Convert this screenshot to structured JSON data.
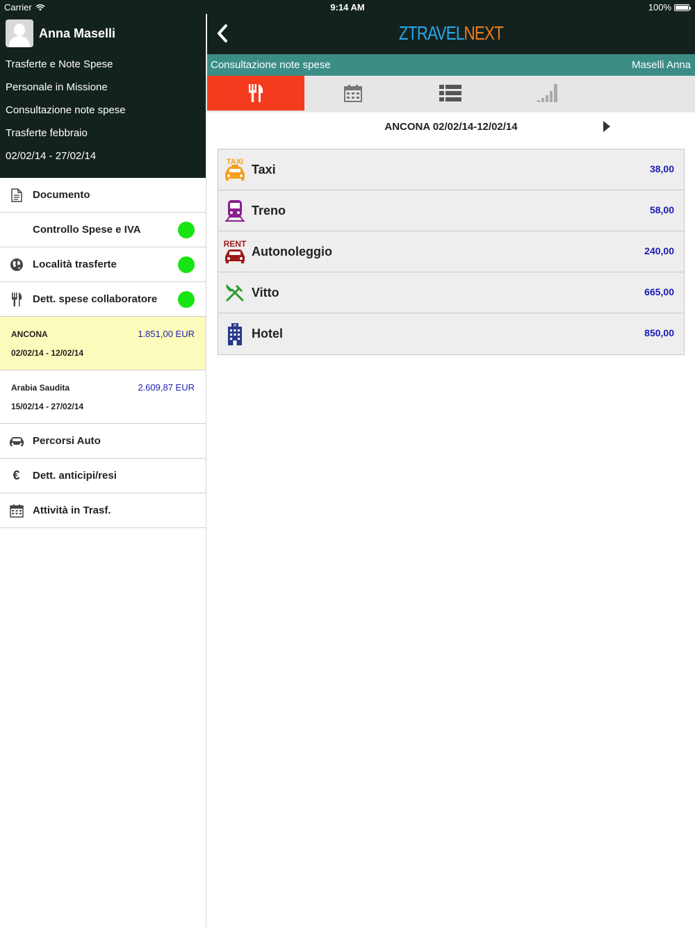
{
  "status": {
    "carrier": "Carrier",
    "time": "9:14 AM",
    "battery": "100%",
    "battery_level": 1.0
  },
  "sidebar": {
    "profile_name": "Anna Maselli",
    "info": [
      "Trasferte e Note Spese",
      "Personale in Missione",
      "Consultazione note spese",
      "Trasferte febbraio",
      "02/02/14 - 27/02/14"
    ],
    "menu_top": [
      {
        "label": "Documento",
        "icon": "document-icon"
      },
      {
        "label": "Controllo Spese e IVA",
        "icon": "",
        "status": "green"
      },
      {
        "label": "Località trasferte",
        "icon": "globe-icon",
        "status": "green"
      },
      {
        "label": "Dett. spese collaboratore",
        "icon": "fork-knife-icon",
        "status": "green"
      }
    ],
    "trips": [
      {
        "name": "ANCONA",
        "dates": "02/02/14 - 12/02/14",
        "amount": "1.851,00 EUR"
      },
      {
        "name": "Arabia Saudita",
        "dates": "15/02/14 - 27/02/14",
        "amount": "2.609,87 EUR"
      }
    ],
    "menu_bottom": [
      {
        "label": "Percorsi Auto",
        "icon": "car-icon"
      },
      {
        "label": "Dett. anticipi/resi",
        "icon": "euro-icon"
      },
      {
        "label": "Attività in Trasf.",
        "icon": "calendar-icon"
      }
    ]
  },
  "header": {
    "logo_left": "ZTRAVEL",
    "logo_right": "NEXT"
  },
  "subbar": {
    "title": "Consultazione note spese",
    "user": "Maselli Anna"
  },
  "period": "ANCONA 02/02/14-12/02/14",
  "expenses": [
    {
      "label": "Taxi",
      "value": "38,00",
      "icon": "taxi-icon",
      "icon_text": "TAXI"
    },
    {
      "label": "Treno",
      "value": "58,00",
      "icon": "train-icon"
    },
    {
      "label": "Autonoleggio",
      "value": "240,00",
      "icon": "rent-car-icon",
      "icon_text": "RENT"
    },
    {
      "label": "Vitto",
      "value": "665,00",
      "icon": "fork-knife-icon"
    },
    {
      "label": "Hotel",
      "value": "850,00",
      "icon": "hotel-icon"
    }
  ],
  "colors": {
    "header_bg": "#14221f",
    "subbar_bg": "#3b8d86",
    "active_tab": "#f43b1e",
    "amount": "#1a1ab8",
    "status_ok": "#18e313",
    "active_trip": "#fbfbbb"
  }
}
